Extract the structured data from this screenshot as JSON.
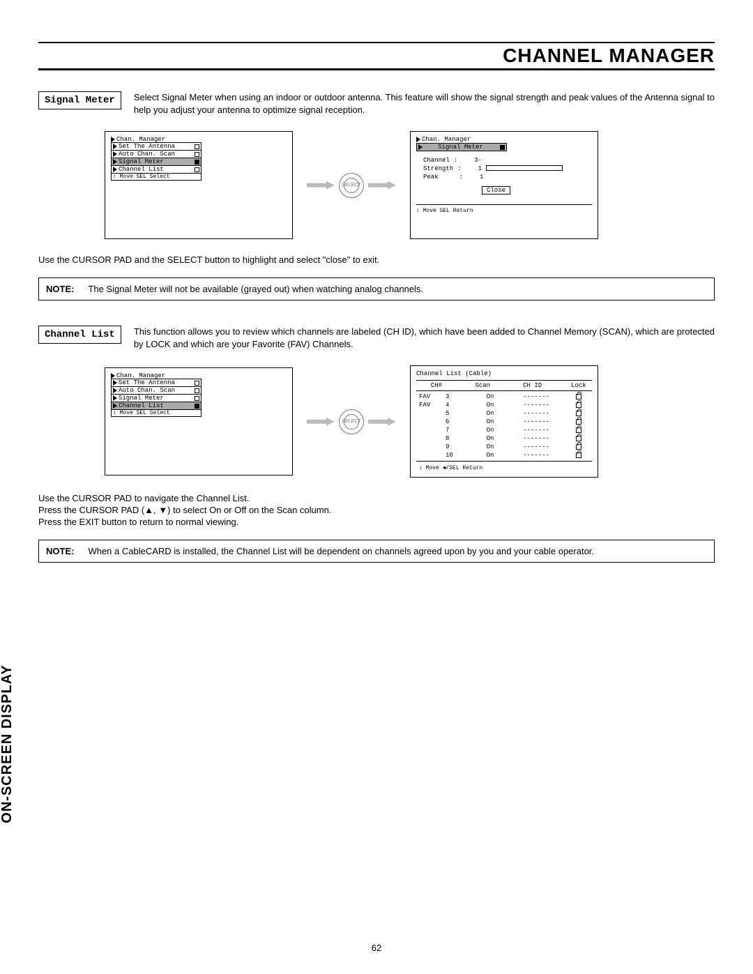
{
  "header": {
    "title": "CHANNEL MANAGER"
  },
  "sidebar": {
    "label": "ON-SCREEN DISPLAY"
  },
  "pageNumber": "62",
  "signalMeter": {
    "label": "Signal Meter",
    "description": "Select Signal Meter when using an indoor or outdoor antenna.  This feature will show the signal strength and peak values of the Antenna signal to help  you adjust your antenna to optimize signal reception.",
    "menuTitle": "Chan. Manager",
    "menuItems": [
      "Set The Antenna",
      "Auto Chan. Scan",
      "Signal Meter",
      "Channel List"
    ],
    "highlightIndex": 2,
    "menuHint": "↕ Move  SEL Select",
    "resultTitle": "Chan. Manager",
    "resultSubtitle": "Signal Meter",
    "channelLabel": "Channel",
    "channelValue": "3-",
    "strengthLabel": "Strength",
    "strengthValue": "1",
    "peakLabel": "Peak",
    "peakValue": "1",
    "closeLabel": "Close",
    "resultHint": "↕ Move SEL Return",
    "exitText": "Use the CURSOR PAD and the SELECT button to highlight and select \"close\" to exit.",
    "noteLabel": "NOTE:",
    "noteText": "The Signal Meter will not be available (grayed out) when watching analog channels."
  },
  "channelList": {
    "label": "Channel List",
    "description": "This function allows you to review which channels are labeled (CH ID), which have been added to Channel Memory (SCAN), which are protected by LOCK and which are your Favorite (FAV) Channels.",
    "menuTitle": "Chan. Manager",
    "menuItems": [
      "Set The Antenna",
      "Auto Chan. Scan",
      "Signal Meter",
      "Channel List"
    ],
    "highlightIndex": 3,
    "menuHint": "↕ Move  SEL Select",
    "listTitle": "Channel List (Cable)",
    "headers": {
      "ch": "CH#",
      "scan": "Scan",
      "chid": "CH ID",
      "lock": "Lock"
    },
    "rows": [
      {
        "fav": "FAV",
        "ch": "3",
        "scan": "On",
        "chid": "-------"
      },
      {
        "fav": "FAV",
        "ch": "4",
        "scan": "On",
        "chid": "-------"
      },
      {
        "fav": "",
        "ch": "5",
        "scan": "On",
        "chid": "-------"
      },
      {
        "fav": "",
        "ch": "6",
        "scan": "On",
        "chid": "-------"
      },
      {
        "fav": "",
        "ch": "7",
        "scan": "On",
        "chid": "-------"
      },
      {
        "fav": "",
        "ch": "8",
        "scan": "On",
        "chid": "-------"
      },
      {
        "fav": "",
        "ch": "9",
        "scan": "On",
        "chid": "-------"
      },
      {
        "fav": "",
        "ch": "10",
        "scan": "On",
        "chid": "-------"
      }
    ],
    "listHint": "↕ Move  ◀/SEL Return",
    "instr1": "Use the CURSOR PAD to navigate the Channel List.",
    "instr2": "Press the CURSOR PAD (▲, ▼) to select On or Off on the Scan column.",
    "instr3": "Press the EXIT button to return to normal viewing.",
    "noteLabel": "NOTE:",
    "noteText": "When a CableCARD is installed, the Channel List will be dependent on channels agreed upon by you and your cable operator."
  }
}
